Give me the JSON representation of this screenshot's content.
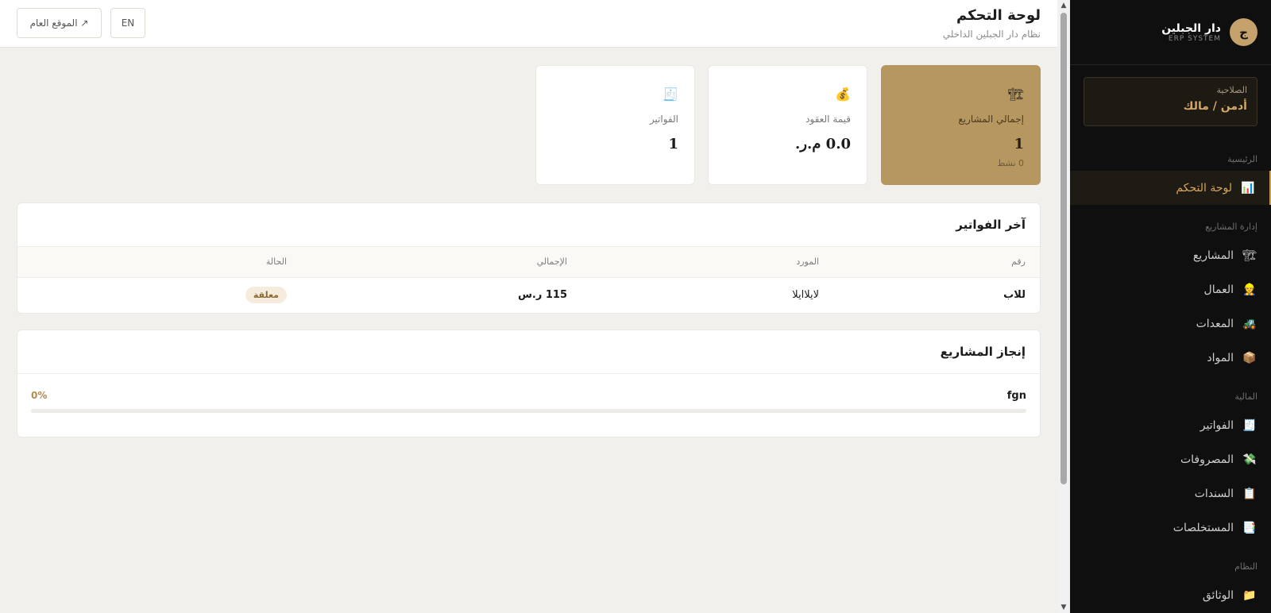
{
  "sidebar": {
    "logo_letter": "ج",
    "brand_name": "دار الجبلين",
    "brand_sub": "ERP SYSTEM",
    "role_label": "الصلاحية",
    "role_value": "أدمن / مالك",
    "sections": {
      "home": "الرئيسية",
      "projects_mgmt": "إدارة المشاريع",
      "finance": "المالية",
      "system": "النظام"
    },
    "items": {
      "dashboard": {
        "label": "لوحة التحكم",
        "icon": "📊",
        "icon_name": "bar-chart-icon"
      },
      "projects": {
        "label": "المشاريع",
        "icon": "🏗",
        "icon_name": "crane-icon"
      },
      "workers": {
        "label": "العمال",
        "icon": "👷",
        "icon_name": "worker-icon"
      },
      "equipment": {
        "label": "المعدات",
        "icon": "🚜",
        "icon_name": "tractor-icon"
      },
      "materials": {
        "label": "المواد",
        "icon": "📦",
        "icon_name": "package-icon"
      },
      "invoices": {
        "label": "الفواتير",
        "icon": "🧾",
        "icon_name": "receipt-icon"
      },
      "expenses": {
        "label": "المصروفات",
        "icon": "💸",
        "icon_name": "money-wings-icon"
      },
      "vouchers": {
        "label": "السندات",
        "icon": "📋",
        "icon_name": "clipboard-icon"
      },
      "extracts": {
        "label": "المستخلصات",
        "icon": "📑",
        "icon_name": "bookmark-tabs-icon"
      },
      "documents": {
        "label": "الوثائق",
        "icon": "📁",
        "icon_name": "folder-icon"
      }
    }
  },
  "header": {
    "title": "لوحة التحكم",
    "subtitle": "نظام دار الجبلين الداخلي",
    "lang_button": "EN",
    "public_site_button": "↗ الموقع العام"
  },
  "stats": {
    "projects": {
      "icon": "🏗",
      "label": "إجمالي المشاريع",
      "value": "1",
      "sub": "0 نشط"
    },
    "contracts": {
      "icon": "💰",
      "label": "قيمة العقود",
      "value": "0.0 م.ر."
    },
    "invoices": {
      "icon": "🧾",
      "label": "الفواتير",
      "value": "1"
    }
  },
  "latest_invoices": {
    "title": "آخر الفواتير",
    "columns": [
      "رقم",
      "المورد",
      "الإجمالي",
      "الحالة"
    ],
    "rows": [
      {
        "number": "للاب",
        "supplier": "لايلاايلا",
        "total": "115 ر.س",
        "status": "معلقة"
      }
    ]
  },
  "projects_progress": {
    "title": "إنجاز المشاريع",
    "items": [
      {
        "name": "fgn",
        "percent_label": "0%",
        "progress": 0
      }
    ]
  },
  "colors": {
    "accent": "#b69760",
    "sidebar_bg": "#0f0f0f",
    "active_text": "#d6a65c"
  }
}
